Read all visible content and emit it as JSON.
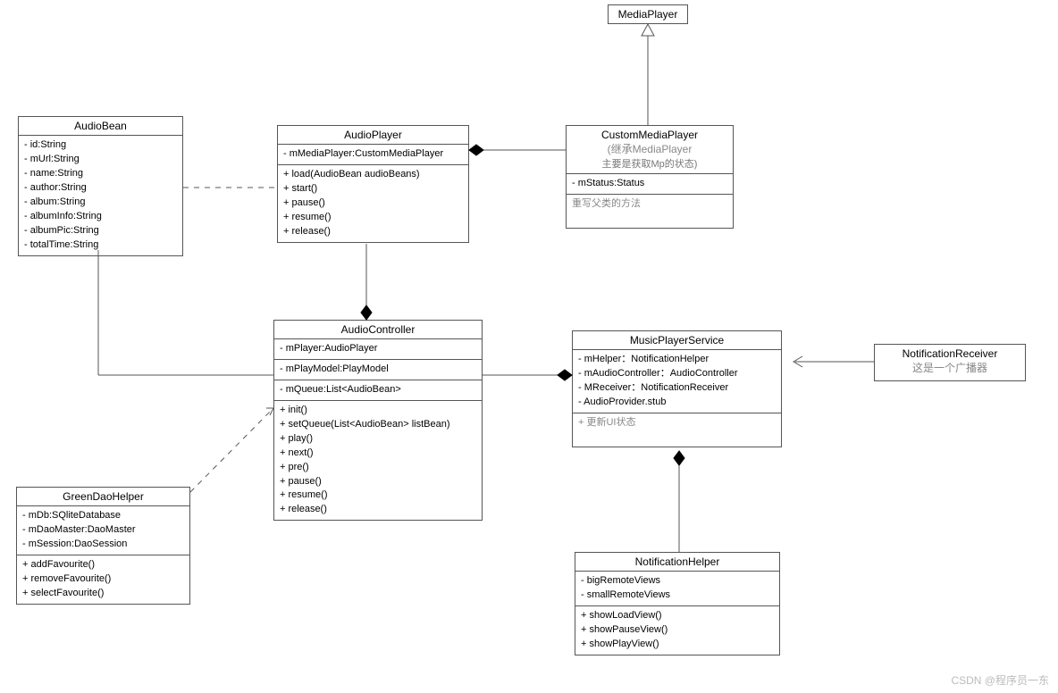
{
  "classes": {
    "MediaPlayer": {
      "name": "MediaPlayer"
    },
    "AudioBean": {
      "name": "AudioBean",
      "attributes": [
        "- id:String",
        "- mUrl:String",
        "- name:String",
        "- author:String",
        "- album:String",
        "- albumInfo:String",
        "- albumPic:String",
        "- totalTime:String"
      ]
    },
    "AudioPlayer": {
      "name": "AudioPlayer",
      "attributes": [
        "- mMediaPlayer:CustomMediaPlayer"
      ],
      "methods": [
        "+ load(AudioBean audioBeans)",
        "+ start()",
        "+ pause()",
        "+ resume()",
        "+ release()"
      ]
    },
    "CustomMediaPlayer": {
      "name": "CustomMediaPlayer",
      "subtitle1": "(继承MediaPlayer",
      "subtitle2": "主要是获取Mp的状态)",
      "attributes": [
        "- mStatus:Status"
      ],
      "note": "重写父类的方法"
    },
    "AudioController": {
      "name": "AudioController",
      "attr1": [
        "- mPlayer:AudioPlayer"
      ],
      "attr2": [
        "- mPlayModel:PlayModel"
      ],
      "attr3": [
        "- mQueue:List<AudioBean>"
      ],
      "methods": [
        "+ init()",
        "+ setQueue(List<AudioBean> listBean)",
        "+ play()",
        "+ next()",
        "+ pre()",
        "+ pause()",
        "+ resume()",
        "+ release()"
      ]
    },
    "MusicPlayerService": {
      "name": "MusicPlayerService",
      "attributes": [
        "- mHelper：NotificationHelper",
        "- mAudioController：AudioController",
        "- MReceiver：NotificationReceiver",
        "- AudioProvider.stub"
      ],
      "note": "+ 更新UI状态"
    },
    "NotificationReceiver": {
      "name": "NotificationReceiver",
      "subtitle": "这是一个广播器"
    },
    "GreenDaoHelper": {
      "name": "GreenDaoHelper",
      "attributes": [
        "- mDb:SQliteDatabase",
        "- mDaoMaster:DaoMaster",
        "- mSession:DaoSession"
      ],
      "methods": [
        "+ addFavourite()",
        "+ removeFavourite()",
        "+ selectFavourite()"
      ]
    },
    "NotificationHelper": {
      "name": "NotificationHelper",
      "attributes": [
        "- bigRemoteViews",
        "- smallRemoteViews"
      ],
      "methods": [
        "+ showLoadView()",
        "+ showPauseView()",
        "+ showPlayView()"
      ]
    }
  },
  "watermark": "CSDN @程序员一东"
}
